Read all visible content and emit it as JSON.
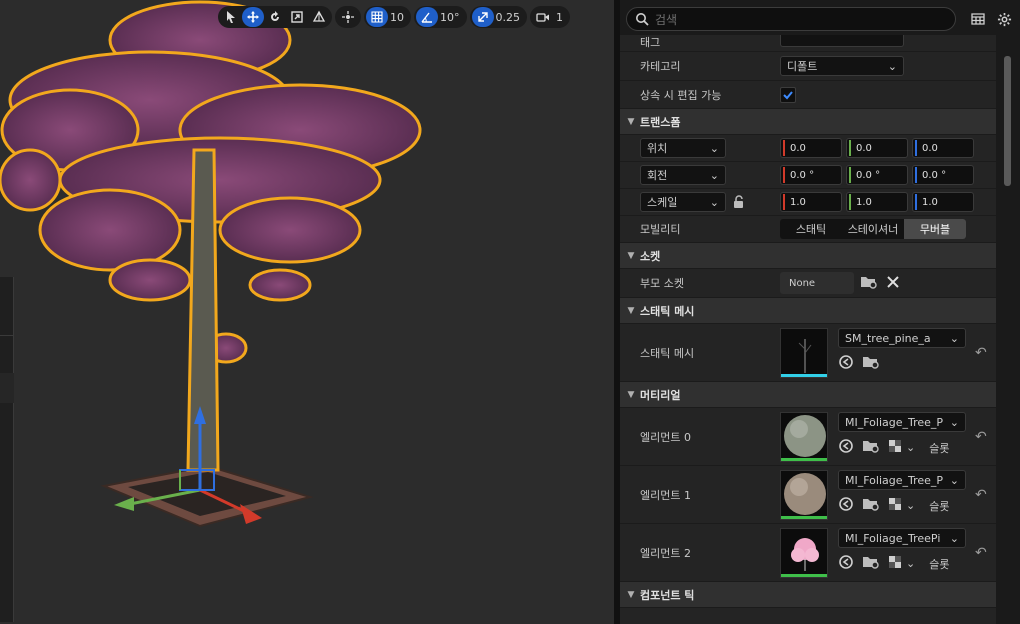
{
  "toolbar": {
    "grid_snap_value": "10",
    "rotation_snap_value": "10°",
    "scale_snap_value": "0.25",
    "camera_speed_value": "1",
    "icons": [
      "select-arrow-icon",
      "translate-icon",
      "rotate-icon",
      "scale-icon",
      "surface-snap-icon",
      "world-local-icon",
      "grid-snap-icon",
      "rotation-snap-icon",
      "scale-snap-icon",
      "camera-speed-icon"
    ]
  },
  "search": {
    "placeholder": "검색"
  },
  "details": {
    "tag_row_label": "태그",
    "category_label": "카테고리",
    "category_value": "디폴트",
    "editable_label": "상속 시 편집 가능",
    "editable_checked": true,
    "transform_section": "트랜스폼",
    "location_label": "위치",
    "location_values": [
      "0.0",
      "0.0",
      "0.0"
    ],
    "rotation_label": "회전",
    "rotation_values": [
      "0.0 °",
      "0.0 °",
      "0.0 °"
    ],
    "scale_label": "스케일",
    "scale_values": [
      "1.0",
      "1.0",
      "1.0"
    ],
    "mobility_label": "모빌리티",
    "mobility_options": [
      "스태틱",
      "스테이셔너",
      "무버블"
    ],
    "mobility_selected": "무버블",
    "socket_section": "소켓",
    "parent_socket_label": "부모 소켓",
    "parent_socket_value": "None",
    "static_mesh_section": "스태틱 메시",
    "static_mesh_label": "스태틱 메시",
    "static_mesh_value": "SM_tree_pine_a",
    "materials_section": "머티리얼",
    "elements": [
      {
        "label": "엘리먼트 0",
        "value": "MI_Foliage_Tree_P",
        "slot_label": "슬롯"
      },
      {
        "label": "엘리먼트 1",
        "value": "MI_Foliage_Tree_P",
        "slot_label": "슬롯"
      },
      {
        "label": "엘리먼트 2",
        "value": "MI_Foliage_TreePi",
        "slot_label": "슬롯"
      }
    ],
    "component_tick_section": "컴포넌트 틱"
  },
  "colors": {
    "accent_blue": "#1f5fc9",
    "axis_x": "#d23a2a",
    "axis_y": "#6ab04c",
    "axis_z": "#2f6fe0",
    "selection_outline": "#f2a81d",
    "mesh_underline": "#32d0e8",
    "material_underline": "#3fbf4a"
  }
}
